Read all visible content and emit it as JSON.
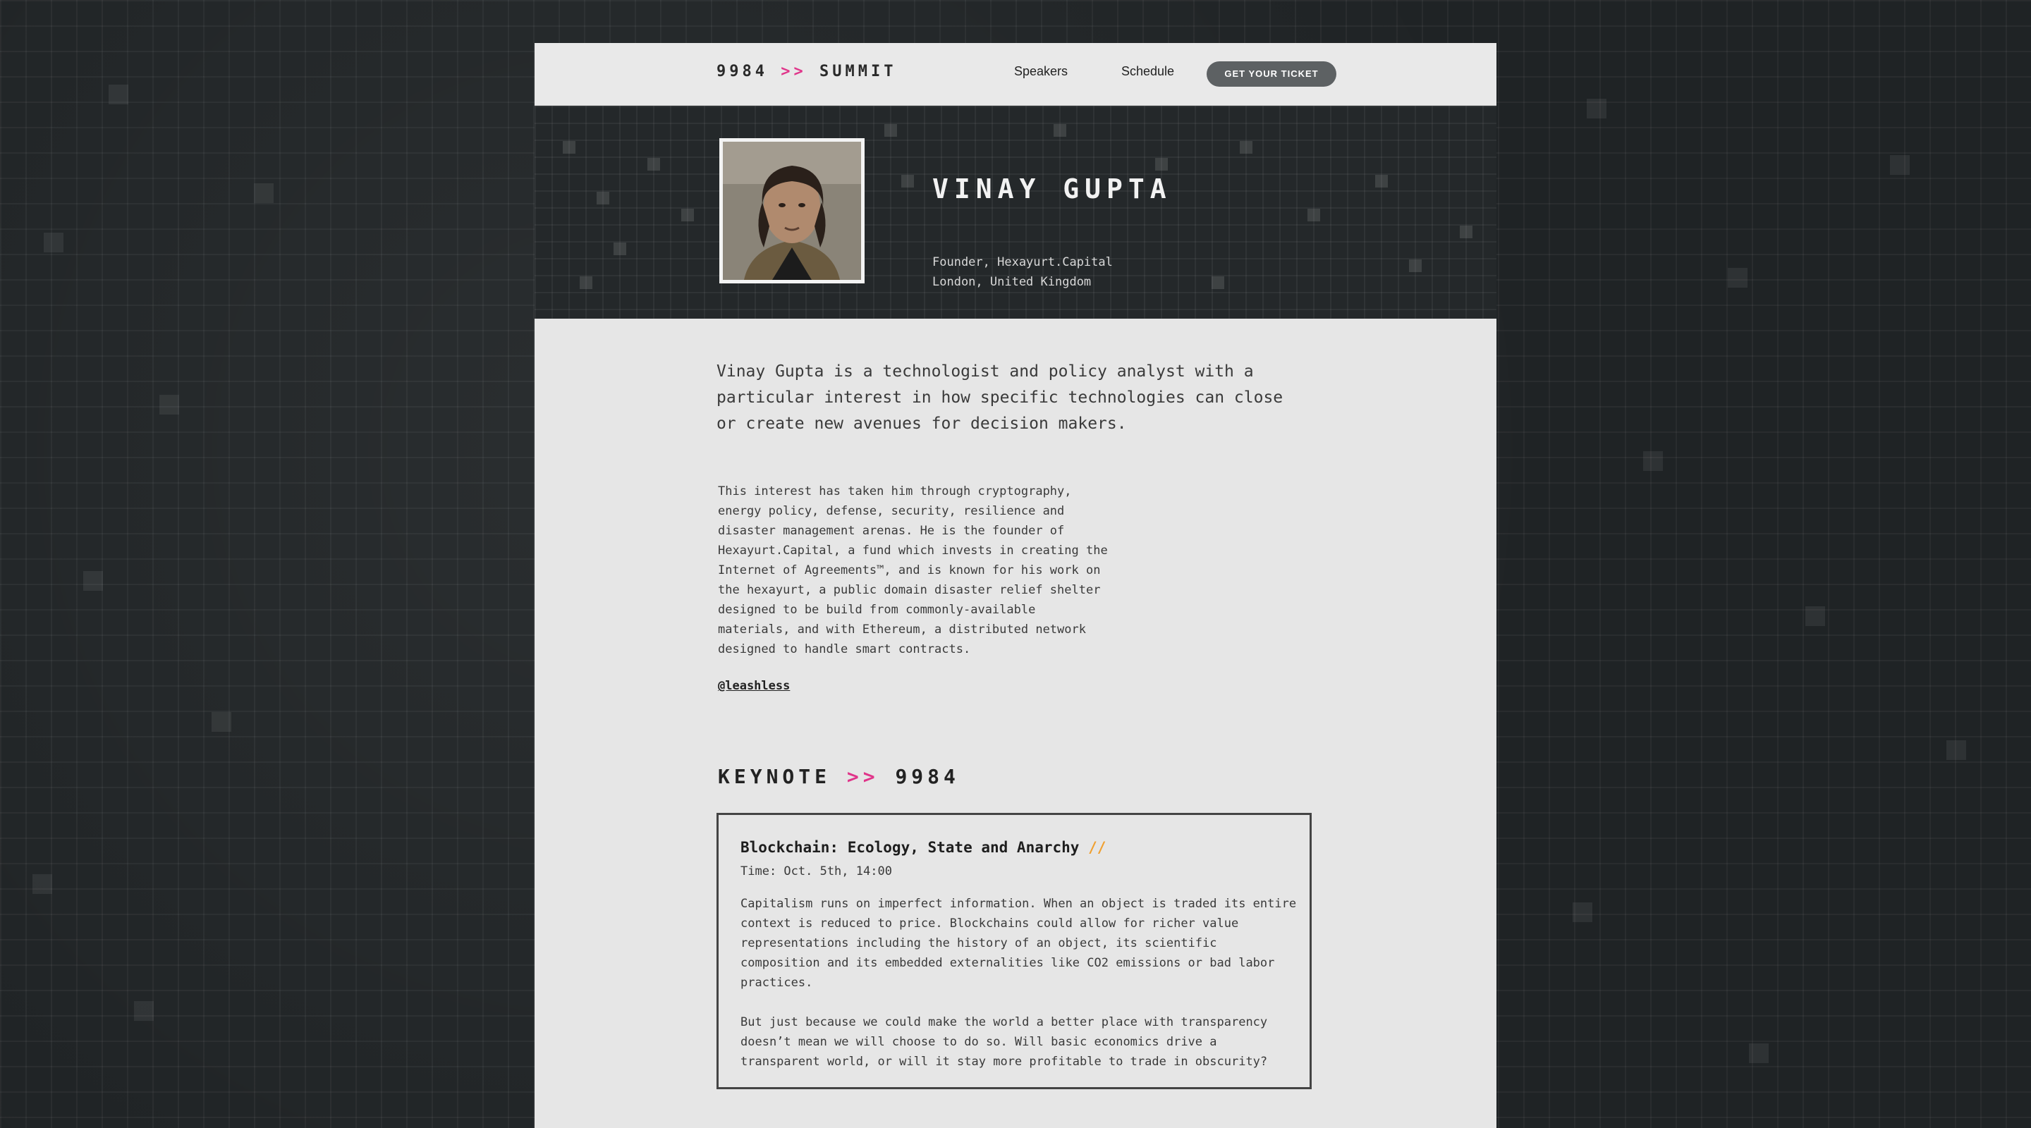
{
  "header": {
    "logo_left": "9984",
    "logo_chevrons": ">>",
    "logo_right": "SUMMIT",
    "nav": [
      "Speakers",
      "Schedule"
    ],
    "cta_label": "GET YOUR TICKET"
  },
  "speaker": {
    "name": "VINAY GUPTA",
    "role": "Founder, Hexayurt.Capital",
    "location": "London, United Kingdom",
    "lead": "Vinay Gupta is a technologist and policy analyst with a particular interest in how specific technologies can close or create new avenues for decision makers.",
    "bio": "This interest has taken him through cryptography, energy policy, defense, security, resilience and disaster management arenas. He is the founder of Hexayurt.Capital, a fund which invests in creating the Internet of Agreements™, and is known for his work on the hexayurt, a public domain disaster relief shelter designed to be build from commonly-available materials, and with Ethereum, a distributed network designed to handle smart contracts.",
    "handle": "@leashless"
  },
  "keynote": {
    "heading_left": "KEYNOTE",
    "heading_chevrons": ">>",
    "heading_right": "9984",
    "talk": {
      "title": "Blockchain: Ecology, State and Anarchy",
      "title_mark": "//",
      "time": "Time: Oct. 5th, 14:00",
      "paragraphs": [
        "Capitalism runs on imperfect information. When an object is traded its entire context is reduced to price. Blockchains could allow for richer value representations including the history of an object, its scientific composition and its embedded externalities like CO2 emissions or bad labor practices.",
        "But just because we could make the world a better place with transparency doesn’t mean we will choose to do so. Will basic economics drive a transparent world, or will it stay more profitable to trade in obscurity?"
      ]
    }
  },
  "colors": {
    "accent_pink": "#e0358a",
    "accent_orange": "#f0a030",
    "page_bg": "#e6e6e6",
    "hero_bg": "#24282a",
    "button_bg": "#5d6163"
  },
  "icons": {
    "logo_chevrons": "double-chevron-right-icon",
    "title_mark": "double-slash-icon"
  }
}
